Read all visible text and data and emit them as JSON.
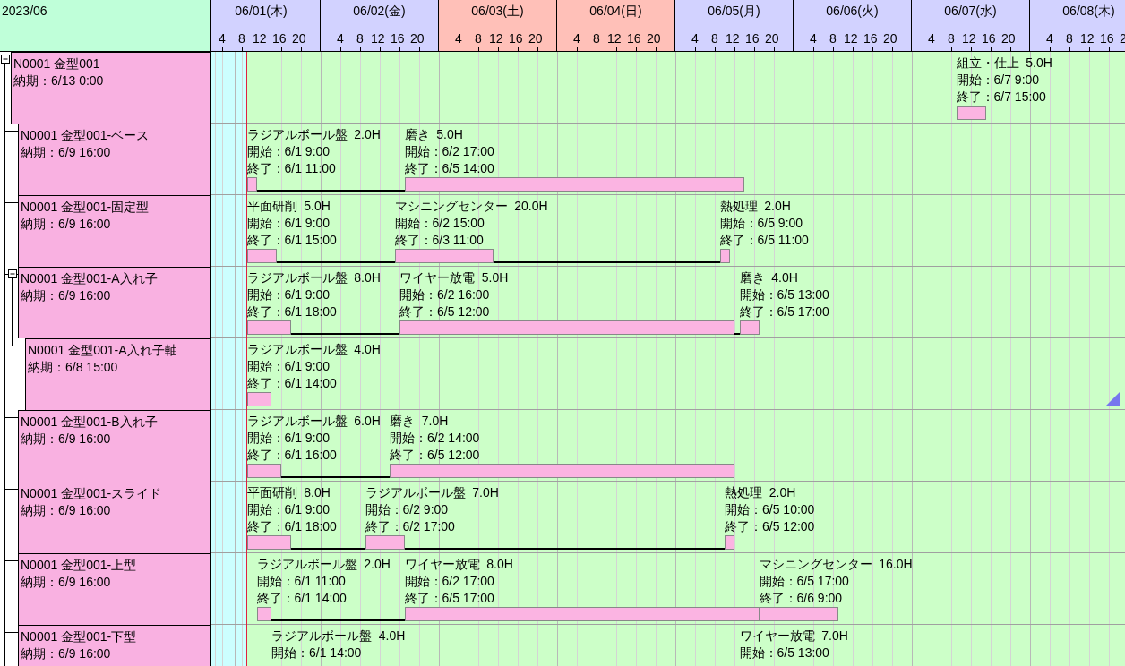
{
  "month": "2023/06",
  "days": [
    {
      "date": "06/01(木)",
      "weekend": false,
      "ticks": [
        "4",
        "8",
        "12",
        "16",
        "20"
      ]
    },
    {
      "date": "06/02(金)",
      "weekend": false,
      "ticks": [
        "4",
        "8",
        "12",
        "16",
        "20"
      ]
    },
    {
      "date": "06/03(土)",
      "weekend": true,
      "ticks": [
        "4",
        "8",
        "12",
        "16",
        "20"
      ]
    },
    {
      "date": "06/04(日)",
      "weekend": true,
      "ticks": [
        "4",
        "8",
        "12",
        "16",
        "20"
      ]
    },
    {
      "date": "06/05(月)",
      "weekend": false,
      "ticks": [
        "4",
        "8",
        "12",
        "16",
        "20"
      ]
    },
    {
      "date": "06/06(火)",
      "weekend": false,
      "ticks": [
        "4",
        "8",
        "12",
        "16",
        "20"
      ]
    },
    {
      "date": "06/07(水)",
      "weekend": false,
      "ticks": [
        "4",
        "8",
        "12",
        "16",
        "20"
      ]
    },
    {
      "date": "06/08(木)",
      "weekend": false,
      "ticks": [
        "4",
        "8",
        "12",
        "16",
        "2"
      ]
    }
  ],
  "tree": [
    {
      "name": "N0001 金型001",
      "due": "納期：6/13 0:00",
      "expanded": true,
      "tasks": [
        {
          "title": "組立・仕上  5.0H",
          "start": "開始：6/7 9:00",
          "end": "終了：6/7 15:00"
        }
      ],
      "children": [
        {
          "name": "N0001 金型001-ベース",
          "due": "納期：6/9 16:00",
          "tasks": [
            {
              "title": "ラジアルボール盤  2.0H",
              "start": "開始：6/1 9:00",
              "end": "終了：6/1 11:00"
            },
            {
              "title": "磨き  5.0H",
              "start": "開始：6/2 17:00",
              "end": "終了：6/5 14:00"
            }
          ]
        },
        {
          "name": "N0001 金型001-固定型",
          "due": "納期：6/9 16:00",
          "tasks": [
            {
              "title": "平面研削  5.0H",
              "start": "開始：6/1 9:00",
              "end": "終了：6/1 15:00"
            },
            {
              "title": "マシニングセンター  20.0H",
              "start": "開始：6/2 15:00",
              "end": "終了：6/3 11:00"
            },
            {
              "title": "熱処理  2.0H",
              "start": "開始：6/5 9:00",
              "end": "終了：6/5 11:00"
            }
          ]
        },
        {
          "name": "N0001 金型001-A入れ子",
          "due": "納期：6/9 16:00",
          "expanded": true,
          "tasks": [
            {
              "title": "ラジアルボール盤  8.0H",
              "start": "開始：6/1 9:00",
              "end": "終了：6/1 18:00"
            },
            {
              "title": "ワイヤー放電  5.0H",
              "start": "開始：6/2 16:00",
              "end": "終了：6/5 12:00"
            },
            {
              "title": "磨き  4.0H",
              "start": "開始：6/5 13:00",
              "end": "終了：6/5 17:00"
            }
          ],
          "children": [
            {
              "name": "N0001 金型001-A入れ子軸",
              "due": "納期：6/8 15:00",
              "corner_mark": true,
              "tasks": [
                {
                  "title": "ラジアルボール盤  4.0H",
                  "start": "開始：6/1 9:00",
                  "end": "終了：6/1 14:00"
                }
              ]
            }
          ]
        },
        {
          "name": "N0001 金型001-B入れ子",
          "due": "納期：6/9 16:00",
          "tasks": [
            {
              "title": "ラジアルボール盤  6.0H",
              "start": "開始：6/1 9:00",
              "end": "終了：6/1 16:00"
            },
            {
              "title": "磨き  7.0H",
              "start": "開始：6/2 14:00",
              "end": "終了：6/5 12:00"
            }
          ]
        },
        {
          "name": "N0001 金型001-スライド",
          "due": "納期：6/9 16:00",
          "tasks": [
            {
              "title": "平面研削  8.0H",
              "start": "開始：6/1 9:00",
              "end": "終了：6/1 18:00"
            },
            {
              "title": "ラジアルボール盤  7.0H",
              "start": "開始：6/2 9:00",
              "end": "終了：6/2 17:00"
            },
            {
              "title": "熱処理  2.0H",
              "start": "開始：6/5 10:00",
              "end": "終了：6/5 12:00"
            }
          ]
        },
        {
          "name": "N0001 金型001-上型",
          "due": "納期：6/9 16:00",
          "tasks": [
            {
              "title": "ラジアルボール盤  2.0H",
              "start": "開始：6/1 11:00",
              "end": "終了：6/1 14:00"
            },
            {
              "title": "ワイヤー放電  8.0H",
              "start": "開始：6/2 17:00",
              "end": "終了：6/5 17:00"
            },
            {
              "title": "マシニングセンター  16.0H",
              "start": "開始：6/5 17:00",
              "end": "終了：6/6 9:00"
            }
          ]
        },
        {
          "name": "N0001 金型001-下型",
          "due": "納期：6/9 16:00",
          "tasks": [
            {
              "title": "ラジアルボール盤  4.0H",
              "start": "開始：6/1 14:00"
            },
            {
              "title": "ワイヤー放電  7.0H",
              "start": "開始：6/5 13:00"
            }
          ]
        }
      ]
    }
  ]
}
